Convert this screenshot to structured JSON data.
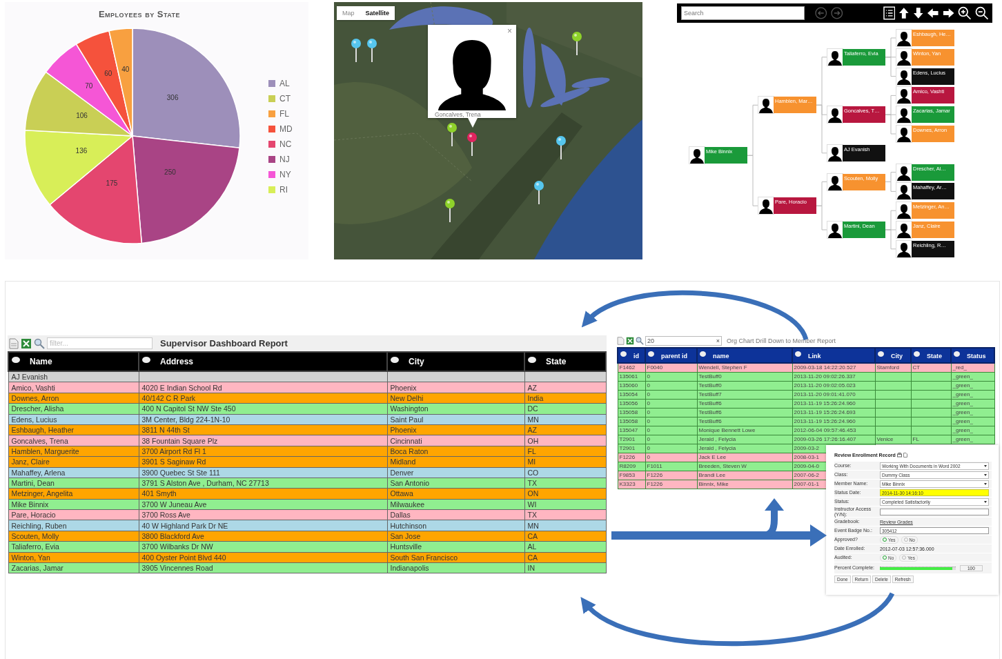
{
  "pie_panel": {
    "chart_data": {
      "type": "pie",
      "title": "Employees by State",
      "categories": [
        "AL",
        "NJ",
        "NC",
        "RI",
        "CT",
        "NY",
        "MD",
        "FL"
      ],
      "values": [
        306,
        250,
        175,
        136,
        106,
        70,
        60,
        40
      ],
      "colors": [
        "#9d8fba",
        "#a94485",
        "#e4466f",
        "#d8ee58",
        "#c9cf55",
        "#f556d6",
        "#f5523c",
        "#f8a040"
      ],
      "legend": "right",
      "data_labels": true
    }
  },
  "map_panel": {
    "tabs": [
      {
        "label": "Map",
        "selected": false
      },
      {
        "label": "Satellite",
        "selected": true
      }
    ],
    "pins": [
      {
        "color": "#56c6ee"
      },
      {
        "color": "#56c6ee"
      },
      {
        "color": "#8ed12a"
      },
      {
        "color": "#8ed12a"
      },
      {
        "color": "#e0245e"
      },
      {
        "color": "#56c6ee"
      },
      {
        "color": "#56c6ee"
      },
      {
        "color": "#8ed12a"
      }
    ],
    "popup": {
      "name": "Goncalves, Trena",
      "close": "×"
    }
  },
  "org_chart": {
    "search_placeholder": "Search",
    "root": {
      "name": "Mike Binnix",
      "color": "#1a9a3a",
      "children": [
        {
          "name": "Hamblen, Mar…",
          "color": "#f7922f",
          "children": [
            {
              "name": "Taliaferro, Evia",
              "color": "#1a9a3a",
              "children": [
                {
                  "name": "Eshbaugh, He…",
                  "color": "#f7922f"
                },
                {
                  "name": "Winton, Yan",
                  "color": "#f7922f"
                },
                {
                  "name": "Edens, Lucius",
                  "color": "#111111"
                }
              ]
            },
            {
              "name": "Goncalves, T…",
              "color": "#b8173f",
              "children": [
                {
                  "name": "Amico, Vashti",
                  "color": "#b8173f"
                },
                {
                  "name": "Zacarias, Jamar",
                  "color": "#1a9a3a"
                },
                {
                  "name": "Downes, Arron",
                  "color": "#f7922f"
                }
              ]
            },
            {
              "name": "AJ Evanish",
              "color": "#111111"
            }
          ]
        },
        {
          "name": "Pare, Horacio",
          "color": "#b8173f",
          "children": [
            {
              "name": "Scouten, Molly",
              "color": "#f7922f",
              "children": [
                {
                  "name": "Drescher, Al…",
                  "color": "#1a9a3a"
                },
                {
                  "name": "Mahaffey, Ar…",
                  "color": "#111111"
                }
              ]
            },
            {
              "name": "Martini, Dean",
              "color": "#1a9a3a",
              "children": [
                {
                  "name": "Metzinger, An…",
                  "color": "#f7922f"
                },
                {
                  "name": "Janz, Claire",
                  "color": "#f7922f"
                },
                {
                  "name": "Reichling, R…",
                  "color": "#111111"
                }
              ]
            }
          ]
        }
      ]
    }
  },
  "left_table": {
    "filter_placeholder": "filter...",
    "title": "Supervisor Dashboard Report",
    "columns": [
      "Name",
      "Address",
      "City",
      "State"
    ],
    "rows": [
      {
        "color": "#d3d3d3",
        "cells": [
          "AJ Evanish"
        ]
      },
      {
        "color": "#ffb6c1",
        "cells": [
          "Amico, Vashti",
          "4020 E Indian School Rd",
          "Phoenix",
          "AZ"
        ]
      },
      {
        "color": "#ffa500",
        "cells": [
          "Downes, Arron",
          "40/142 C R Park",
          "New Delhi",
          "India"
        ]
      },
      {
        "color": "#90ee90",
        "cells": [
          "Drescher, Alisha",
          "400 N Capitol St NW Ste 450",
          "Washington",
          "DC"
        ]
      },
      {
        "color": "#add8e6",
        "cells": [
          "Edens, Lucius",
          "3M Center, Bldg 224-1N-10",
          "Saint Paul",
          "MN"
        ]
      },
      {
        "color": "#ffa500",
        "cells": [
          "Eshbaugh, Heather",
          "3811 N 44th St",
          "Phoenix",
          "AZ"
        ]
      },
      {
        "color": "#ffb6c1",
        "cells": [
          "Goncalves, Trena",
          "38 Fountain Square Plz",
          "Cincinnati",
          "OH"
        ]
      },
      {
        "color": "#ffa500",
        "cells": [
          "Hamblen, Marguerite",
          "3700 Airport Rd Fl 1",
          "Boca Raton",
          "FL"
        ]
      },
      {
        "color": "#ffa500",
        "cells": [
          "Janz, Claire",
          "3901 S Saginaw Rd",
          "Midland",
          "MI"
        ]
      },
      {
        "color": "#add8e6",
        "cells": [
          "Mahaffey, Arlena",
          "3900 Quebec St Ste 111",
          "Denver",
          "CO"
        ]
      },
      {
        "color": "#90ee90",
        "cells": [
          "Martini, Dean",
          "3791 S Alston Ave , Durham, NC 27713",
          "San Antonio",
          "TX"
        ]
      },
      {
        "color": "#ffa500",
        "cells": [
          "Metzinger, Angelita",
          "401 Smyth",
          "Ottawa",
          "ON"
        ]
      },
      {
        "color": "#90ee90",
        "cells": [
          "Mike Binnix",
          "3700 W Juneau Ave",
          "Milwaukee",
          "WI"
        ]
      },
      {
        "color": "#ffb6c1",
        "cells": [
          "Pare, Horacio",
          "3700 Ross Ave",
          "Dallas",
          "TX"
        ]
      },
      {
        "color": "#add8e6",
        "cells": [
          "Reichling, Ruben",
          "40 W Highland Park Dr NE",
          "Hutchinson",
          "MN"
        ]
      },
      {
        "color": "#ffa500",
        "cells": [
          "Scouten, Molly",
          "3800 Blackford Ave",
          "San Jose",
          "CA"
        ]
      },
      {
        "color": "#90ee90",
        "cells": [
          "Taliaferro, Evia",
          "3700 Wilbanks Dr NW",
          "Huntsville",
          "AL"
        ]
      },
      {
        "color": "#ffa500",
        "cells": [
          "Winton, Yan",
          "400 Oyster Point Blvd 440",
          "South San Francisco",
          "CA"
        ]
      },
      {
        "color": "#90ee90",
        "cells": [
          "Zacarias, Jamar",
          "3905 Vincennes Road",
          "Indianapolis",
          "IN"
        ]
      }
    ]
  },
  "right_table": {
    "filter_value": "20",
    "clear": "×",
    "title": "Org Chart Drill Down to Member Report",
    "columns": [
      "id",
      "parent id",
      "name",
      "Link",
      "City",
      "State",
      "Status"
    ],
    "rows": [
      {
        "color": "#ffb6c1",
        "cells": [
          "F1462",
          "F0040",
          "Wendell, Stephen F",
          "2009-03-18 14:22:20.527",
          "Stamford",
          "CT",
          "_red_"
        ]
      },
      {
        "color": "#90ee90",
        "cells": [
          "135061",
          "0",
          "TestBuff0",
          "2013-11-20 09:02:26.337",
          null,
          null,
          "_green_"
        ]
      },
      {
        "color": "#90ee90",
        "cells": [
          "135060",
          "0",
          "TestBuff0",
          "2013-11-20 09:02:05.023",
          null,
          null,
          "_green_"
        ]
      },
      {
        "color": "#90ee90",
        "cells": [
          "135054",
          "0",
          "TestBuff7",
          "2013-11-20 09:01:41.070",
          null,
          null,
          "_green_"
        ]
      },
      {
        "color": "#90ee90",
        "cells": [
          "135056",
          "0",
          "TestBuff6",
          "2013-11-19 15:26:24.960",
          null,
          null,
          "_green_"
        ]
      },
      {
        "color": "#90ee90",
        "cells": [
          "135058",
          "0",
          "TestBuff6",
          "2013-11-19 15:26:24.693",
          null,
          null,
          "_green_"
        ]
      },
      {
        "color": "#90ee90",
        "cells": [
          "135058",
          "0",
          "TestBuff6",
          "2013-11-19 15:26:24.960",
          null,
          null,
          "_green_"
        ]
      },
      {
        "color": "#90ee90",
        "cells": [
          "135047",
          "0",
          "Monique Bennett Lowe",
          "2012-06-04 09:57:46.453",
          null,
          null,
          "_green_"
        ]
      },
      {
        "color": "#90ee90",
        "cells": [
          "T2901",
          "0",
          "Jerald , Felycia",
          "2009-03-26 17:26:16.407",
          "Venice",
          "FL",
          "_green_"
        ]
      },
      {
        "color": "#90ee90",
        "cells": [
          "T2901",
          "0",
          "Jerald , Felycia",
          "2009-03-2"
        ]
      },
      {
        "color": "#ffb6c1",
        "cells": [
          "F1226",
          "0",
          "Jack E Lee",
          "2008-03-1"
        ]
      },
      {
        "color": "#90ee90",
        "cells": [
          "R8209",
          "F1011",
          "Breeden, Steven W",
          "2009-04-0"
        ]
      },
      {
        "color": "#ffb6c1",
        "cells": [
          "F9853",
          "F1226",
          "Brandi Lee",
          "2007-06-2"
        ]
      },
      {
        "color": "#ffb6c1",
        "cells": [
          "K3323",
          "F1226",
          "Binnix, Mike",
          "2007-01-1"
        ]
      }
    ]
  },
  "enrollment_form": {
    "title": "Review Enrollment Record",
    "fields": [
      {
        "kind": "select",
        "label": "Course:",
        "value": "Working With Documents in Word 2002"
      },
      {
        "kind": "select",
        "label": "Class:",
        "value": "Dummy Class"
      },
      {
        "kind": "select",
        "label": "Member Name:",
        "value": "Mike Binnix"
      },
      {
        "kind": "input",
        "label": "Status Date:",
        "value": "2014-11-30 14:16:10",
        "highlighted": true
      },
      {
        "kind": "select",
        "label": "Status:",
        "value": "Completed Satisfactorily"
      },
      {
        "kind": "input",
        "label": "Instructor Access (Y/N):",
        "highlighted": false
      },
      {
        "kind": "link",
        "label": "Gradebook:",
        "value": "Review Grades"
      },
      {
        "kind": "input",
        "label": "Event Badge No.:",
        "value": "305412",
        "highlighted": false
      },
      {
        "kind": "radio",
        "label": "Approved?",
        "options": [
          {
            "label": "Yes",
            "selected": true
          },
          {
            "label": "No",
            "selected": false
          }
        ]
      },
      {
        "kind": "text",
        "label": "Date Enrolled:",
        "value": "2012-07-03 12:57:36.000"
      },
      {
        "kind": "radio",
        "label": "Audited:",
        "options": [
          {
            "label": "No",
            "selected": true
          },
          {
            "label": "Yes",
            "selected": false
          }
        ]
      },
      {
        "kind": "slider",
        "label": "Percent Complete:",
        "level": 0.95,
        "reading": "100"
      }
    ],
    "buttons": [
      "Done",
      "Return",
      "Delete",
      "Refresh"
    ]
  }
}
